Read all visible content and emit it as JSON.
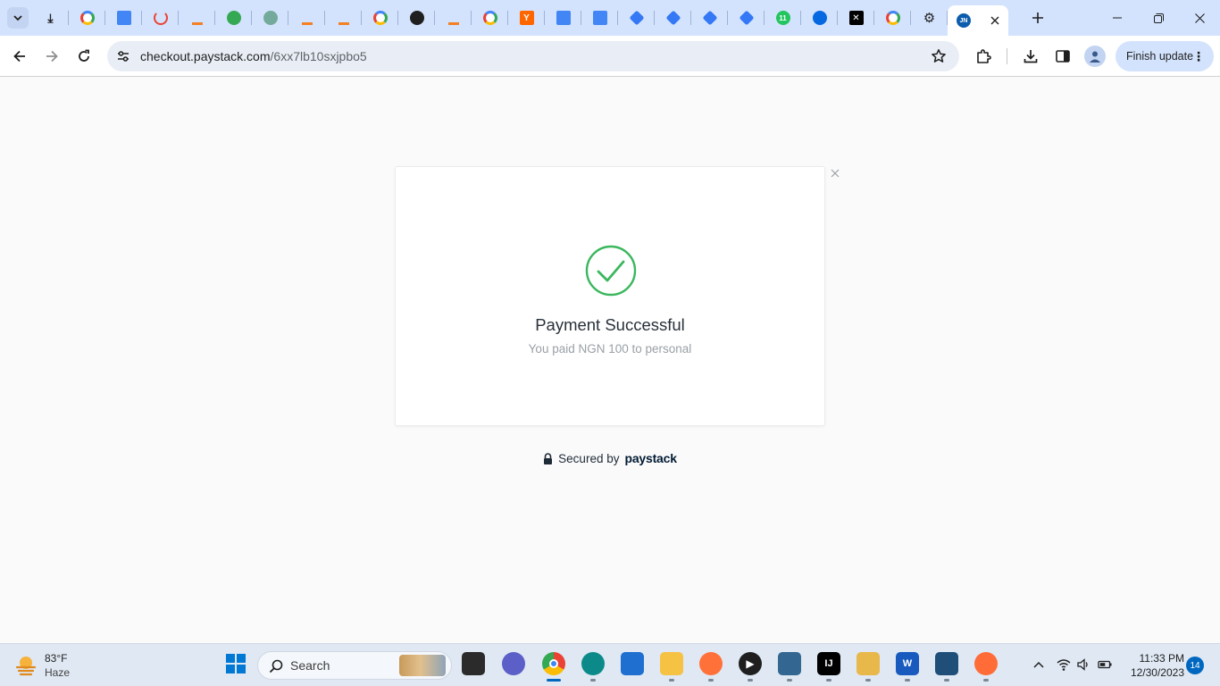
{
  "browser": {
    "tabs": [
      {
        "icon": "download-icon",
        "color": "#1f1f1f"
      },
      {
        "icon": "google-icon",
        "color": "#4285f4"
      },
      {
        "icon": "docs-icon",
        "color": "#4285f4"
      },
      {
        "icon": "refresh-red-icon",
        "color": "#ea4335"
      },
      {
        "icon": "stack-icon",
        "color": "#f48024"
      },
      {
        "icon": "green-circle-icon",
        "color": "#34a853"
      },
      {
        "icon": "chatgpt-icon",
        "color": "#74aa9c"
      },
      {
        "icon": "stack-icon",
        "color": "#f48024"
      },
      {
        "icon": "stack-icon",
        "color": "#f48024"
      },
      {
        "icon": "google-icon",
        "color": "#4285f4"
      },
      {
        "icon": "github-icon",
        "color": "#1f1f1f"
      },
      {
        "icon": "stack-icon",
        "color": "#f48024"
      },
      {
        "icon": "google-icon",
        "color": "#4285f4"
      },
      {
        "icon": "y-combinator-icon",
        "color": "#ff6600"
      },
      {
        "icon": "docs-icon",
        "color": "#4285f4"
      },
      {
        "icon": "docs-icon",
        "color": "#4285f4"
      },
      {
        "icon": "diamond-icon",
        "color": "#3478f6"
      },
      {
        "icon": "diamond-icon",
        "color": "#3478f6"
      },
      {
        "icon": "diamond-icon",
        "color": "#3478f6"
      },
      {
        "icon": "diamond-icon",
        "color": "#3478f6"
      },
      {
        "icon": "green-badge-icon",
        "color": "#22c55e"
      },
      {
        "icon": "meta-icon",
        "color": "#0668e1"
      },
      {
        "icon": "x-icon",
        "color": "#000000"
      },
      {
        "icon": "google-icon",
        "color": "#4285f4"
      },
      {
        "icon": "gear-icon",
        "color": "#1f1f1f"
      }
    ],
    "tab_labels": {
      "y_combinator": "Y",
      "green_badge": "11",
      "active_favicon": "JN"
    },
    "active_tab": {
      "icon": "jn-icon",
      "color": "#0b5cad"
    },
    "address": {
      "domain": "checkout.paystack.com",
      "path": "/6xx7lb10sxjpbo5"
    },
    "finish_update_label": "Finish update"
  },
  "checkout": {
    "title": "Payment Successful",
    "subtitle": "You paid NGN 100 to personal",
    "secured_label": "Secured by",
    "brand": "paystack",
    "success_color": "#3bb75e"
  },
  "taskbar": {
    "weather": {
      "temp": "83°F",
      "condition": "Haze"
    },
    "search_label": "Search",
    "apps": [
      {
        "name": "start-button",
        "label": "",
        "color": "#0078d4"
      },
      {
        "name": "task-view-icon",
        "label": "",
        "color": "#2b2b2b"
      },
      {
        "name": "teams-chat-icon",
        "label": "",
        "color": "#5b5fc7"
      },
      {
        "name": "chrome-icon",
        "label": "",
        "color": "#4285f4"
      },
      {
        "name": "edge-icon",
        "label": "",
        "color": "#0c8a8a"
      },
      {
        "name": "store-icon",
        "label": "",
        "color": "#1e6fd0"
      },
      {
        "name": "file-explorer-icon",
        "label": "",
        "color": "#f6c244"
      },
      {
        "name": "firefox-icon",
        "label": "",
        "color": "#ff7139"
      },
      {
        "name": "media-player-icon",
        "label": "",
        "color": "#1f1f1f"
      },
      {
        "name": "postgres-icon",
        "label": "",
        "color": "#336791"
      },
      {
        "name": "intellij-icon",
        "label": "IJ",
        "color": "#000000"
      },
      {
        "name": "git-icon",
        "label": "",
        "color": "#e8b84a"
      },
      {
        "name": "word-icon",
        "label": "W",
        "color": "#185abd"
      },
      {
        "name": "sql-developer-icon",
        "label": "",
        "color": "#1f4e79"
      },
      {
        "name": "postman-icon",
        "label": "",
        "color": "#ff6c37"
      }
    ],
    "clock": {
      "time": "11:33 PM",
      "date": "12/30/2023"
    },
    "notifications": "14"
  }
}
